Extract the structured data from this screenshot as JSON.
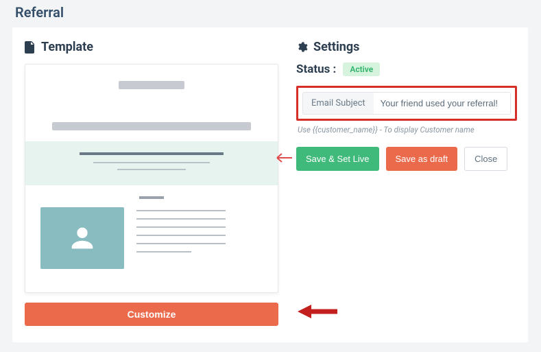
{
  "page": {
    "title": "Referral"
  },
  "template": {
    "heading": "Template",
    "customize_label": "Customize"
  },
  "settings": {
    "heading": "Settings",
    "status_label": "Status :",
    "status_value": "Active",
    "email_subject_label": "Email Subject",
    "email_subject_value": "Your friend used your referral!",
    "hint": "Use {{customer_name}} - To display Customer name",
    "buttons": {
      "save_live": "Save & Set Live",
      "save_draft": "Save as draft",
      "close": "Close"
    }
  }
}
